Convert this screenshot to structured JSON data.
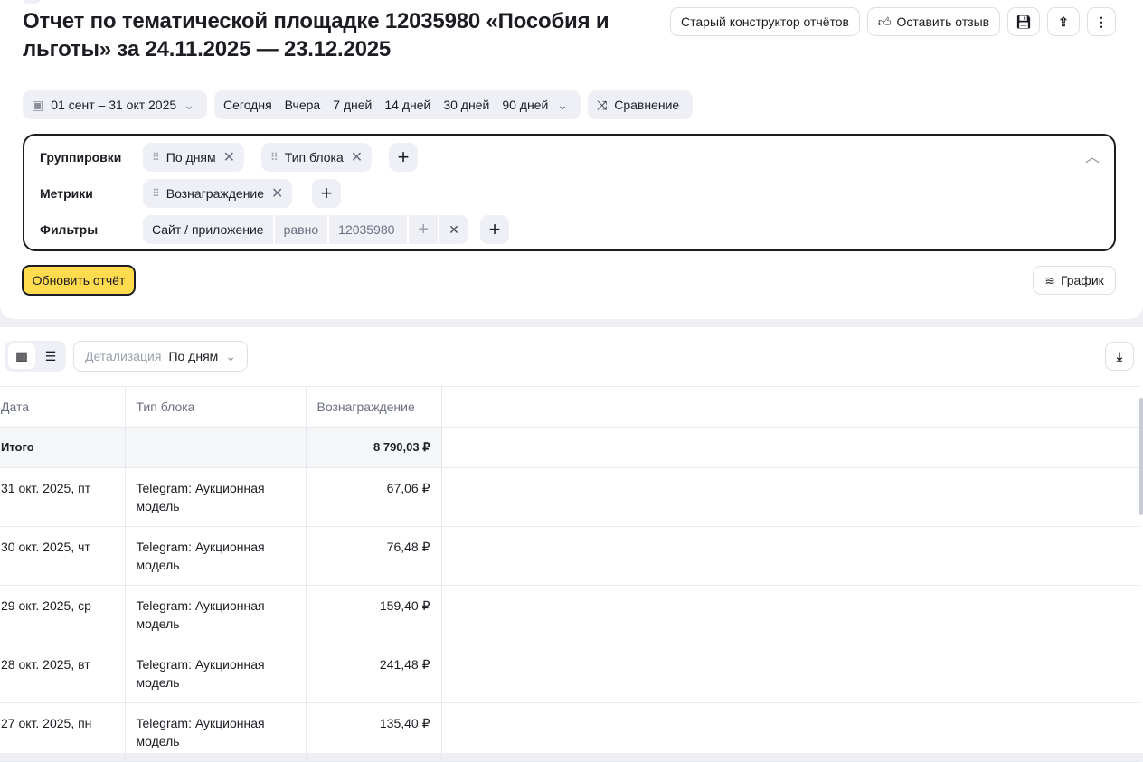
{
  "title": "Отчет по тематической площадке 12035980 «Пособия и льготы» за 24.11.2025 — 23.12.2025",
  "header_buttons": {
    "old_constructor": "Старый конструктор отчётов",
    "feedback": "Оставить отзыв"
  },
  "date_range": "01 сент – 31 окт 2025",
  "presets": [
    "Сегодня",
    "Вчера",
    "7 дней",
    "14 дней",
    "30 дней",
    "90 дней"
  ],
  "compare": "Сравнение",
  "groupings": {
    "label": "Группировки",
    "items": [
      "По дням",
      "Тип блока"
    ]
  },
  "metrics": {
    "label": "Метрики",
    "items": [
      "Вознаграждение"
    ]
  },
  "filters": {
    "label": "Фильтры",
    "field": "Сайт / приложение",
    "operator": "равно",
    "value": "12035980"
  },
  "update_button": "Обновить отчёт",
  "chart_button": "График",
  "detail": {
    "label": "Детализация",
    "value": "По дням"
  },
  "table": {
    "columns": [
      "Дата",
      "Тип блока",
      "Вознаграждение"
    ],
    "total": {
      "label": "Итого",
      "value": "8 790,03 ₽"
    },
    "rows": [
      {
        "date": "31 окт. 2025, пт",
        "type": "Telegram: Аукционная модель",
        "value": "67,06 ₽"
      },
      {
        "date": "30 окт. 2025, чт",
        "type": "Telegram: Аукционная модель",
        "value": "76,48 ₽"
      },
      {
        "date": "29 окт. 2025, ср",
        "type": "Telegram: Аукционная модель",
        "value": "159,40 ₽"
      },
      {
        "date": "28 окт. 2025, вт",
        "type": "Telegram: Аукционная модель",
        "value": "241,48 ₽"
      },
      {
        "date": "27 окт. 2025, пн",
        "type": "Telegram: Аукционная модель",
        "value": "135,40 ₽"
      }
    ]
  }
}
